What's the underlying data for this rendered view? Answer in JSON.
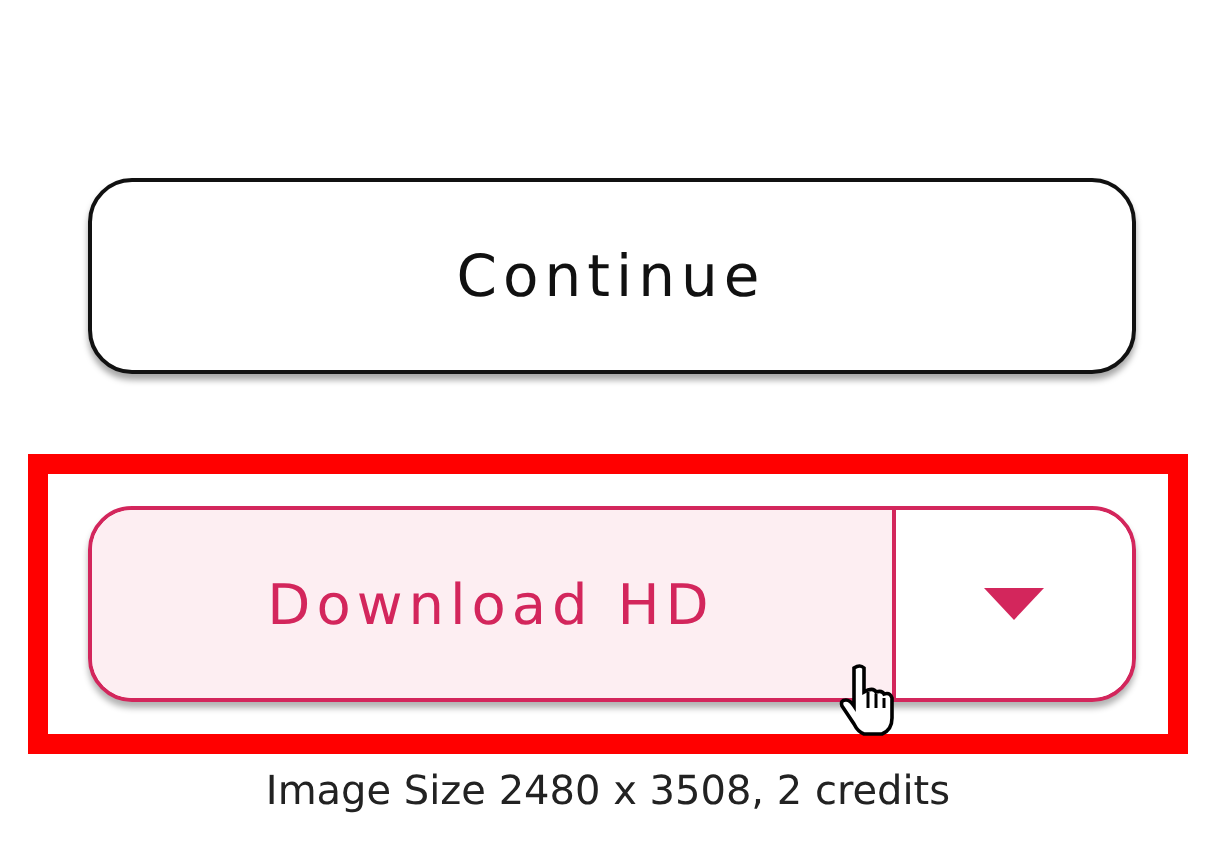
{
  "continue_button": {
    "label": "Continue"
  },
  "download": {
    "label": "Download HD",
    "highlighted": true,
    "dropdown": {
      "expanded": false
    }
  },
  "caption": "Image Size 2480 x 3508, 2 credits"
}
